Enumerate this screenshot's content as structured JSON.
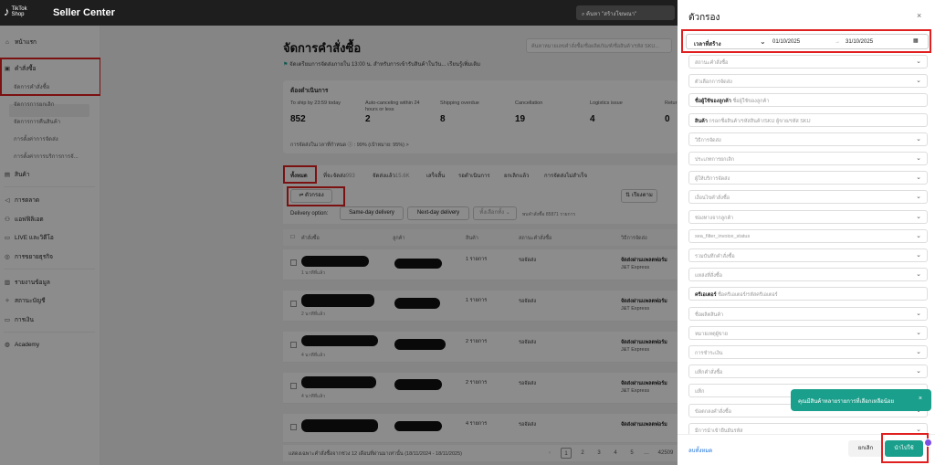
{
  "topbar": {
    "logo_line1": "TikTok",
    "logo_line2": "Shop",
    "title": "Seller Center",
    "search_placeholder": "ค้นหา \"สร้างโฆษณา\""
  },
  "sidebar": {
    "home": "หน้าแรก",
    "orders": "คำสั่งซื้อ",
    "orders_sub": [
      "จัดการคำสั่งซื้อ",
      "จัดการการยกเลิก",
      "จัดการการคืนสินค้า",
      "การตั้งค่าการจัดส่ง",
      "การตั้งค่าการบริการการจั..."
    ],
    "products": "สินค้า",
    "marketing": "การตลาด",
    "affiliate": "แอฟฟิลิเอต",
    "live": "LIVE และวิดีโอ",
    "promotion": "การขยายธุรกิจ",
    "reports": "รายงานข้อมูล",
    "account_health": "สถานะบัญชี",
    "finance": "การเงิน",
    "academy": "Academy"
  },
  "main": {
    "page_title": "จัดการคำสั่งซื้อ",
    "notice": "จัดเตรียมการจัดส่งภายใน 13:00 น. สำหรับการเข้ารับสินค้าในวัน...  เรียนรู้เพิ่มเติม",
    "search_placeholder": "ค้นหาหมายเลขคำสั่งซื้อ/ชื่อผลิตภัณฑ์/ชื่อสินค้า/รหัส SKU...",
    "todo_header": "ต้องดำเนินการ",
    "stats": [
      {
        "label": "To ship by 23:59 today",
        "value": "852"
      },
      {
        "label": "Auto-canceling within 24 hours or less",
        "value": "2"
      },
      {
        "label": "Shipping overdue",
        "value": "8"
      },
      {
        "label": "Cancellation",
        "value": "19"
      },
      {
        "label": "Logistics issue",
        "value": "4"
      },
      {
        "label": "Retur",
        "value": "0"
      }
    ],
    "ontime_rate": "การจัดส่งในเวลาที่กำหนด ⓘ : 99% (เป้าหมาย: 95%) >",
    "tabs": [
      {
        "label": "ทั้งหมด",
        "count": ""
      },
      {
        "label": "ที่จะจัดส่ง",
        "count": "993"
      },
      {
        "label": "จัดส่งแล้ว",
        "count": "15.6K"
      },
      {
        "label": "เสร็จสิ้น",
        "count": ""
      },
      {
        "label": "รอดำเนินการ",
        "count": ""
      },
      {
        "label": "ยกเลิกแล้ว",
        "count": ""
      },
      {
        "label": "การจัดส่งไม่สำเร็จ",
        "count": ""
      }
    ],
    "filter_button": "ตัวกรอง",
    "sort_button": "เรียงตาม",
    "delivery_option_label": "Delivery option:",
    "same_day": "Same-day delivery",
    "next_day": "Next-day delivery",
    "select_all": "ทั้งเลือกทั้ง",
    "selected_info": "พบคำสั่งซื้อ 85871 รายการ",
    "columns": [
      "คำสั่งซื้อ",
      "ลูกค้า",
      "สินค้า",
      "สถานะคำสั่งซื้อ",
      "วิธีการจัดส่ง"
    ],
    "rows": [
      {
        "meta": "1 นาทีที่แล้ว",
        "items": "1 รายการ",
        "status": "รอจัดส่ง",
        "ship": "จัดส่งผ่านแพลตฟอร์ม",
        "carrier": "J&T Express"
      },
      {
        "meta": "2 นาทีที่แล้ว",
        "items": "1 รายการ",
        "status": "รอจัดส่ง",
        "ship": "จัดส่งผ่านแพลตฟอร์ม",
        "carrier": "J&T Express"
      },
      {
        "meta": "4 นาทีที่แล้ว",
        "items": "2 รายการ",
        "status": "รอจัดส่ง",
        "ship": "จัดส่งผ่านแพลตฟอร์ม",
        "carrier": "J&T Express"
      },
      {
        "meta": "4 นาทีที่แล้ว",
        "items": "2 รายการ",
        "status": "รอจัดส่ง",
        "ship": "จัดส่งผ่านแพลตฟอร์ม",
        "carrier": "J&T Express"
      },
      {
        "meta": "",
        "items": "4 รายการ",
        "status": "รอจัดส่ง",
        "ship": "จัดส่งผ่านแพลตฟอร์ม",
        "carrier": ""
      }
    ],
    "pagination_info": "แสดงเฉพาะคำสั่งซื้อจากช่วง 12 เดือนที่ผ่านมาเท่านั้น (18/11/2024 - 18/11/2025)",
    "pages": [
      "1",
      "2",
      "3",
      "4",
      "5"
    ],
    "last_page": "42509"
  },
  "filter_panel": {
    "title": "ตัวกรอง",
    "date_type": "เวลาที่สร้าง",
    "date_from": "01/10/2025",
    "date_to": "31/10/2025",
    "fields": [
      {
        "label": "",
        "placeholder": "สถานะคำสั่งซื้อ",
        "dropdown": true
      },
      {
        "label": "",
        "placeholder": "ตัวเลือกการจัดส่ง",
        "dropdown": true
      },
      {
        "label": "ชื่อผู้ใช้ของลูกค้า",
        "placeholder": "ชื่อผู้ใช้ของลูกค้า",
        "dropdown": false
      },
      {
        "label": "สินค้า",
        "placeholder": "กรอกชื่อสินค้า/รหัสสินค้า/SKU ผู้ขาย/รหัส SKU",
        "dropdown": false
      },
      {
        "label": "",
        "placeholder": "วิธีการจัดส่ง",
        "dropdown": true
      },
      {
        "label": "",
        "placeholder": "ประเภทการยกเลิก",
        "dropdown": true
      },
      {
        "label": "",
        "placeholder": "ผู้ให้บริการจัดส่ง",
        "dropdown": true
      },
      {
        "label": "",
        "placeholder": "เงื่อนไขคำสั่งซื้อ",
        "dropdown": true
      },
      {
        "label": "",
        "placeholder": "ช่องทางจากลูกค้า",
        "dropdown": true
      },
      {
        "label": "",
        "placeholder": "sea_filter_invoice_status",
        "dropdown": true
      },
      {
        "label": "",
        "placeholder": "รวมบันทึกคำสั่งซื้อ",
        "dropdown": true
      },
      {
        "label": "",
        "placeholder": "แหล่งที่สั่งซื้อ",
        "dropdown": true
      },
      {
        "label": "ครีเอเตอร์",
        "placeholder": "ชื่อครีเอเตอร์/รหัสครีเอเตอร์",
        "dropdown": false
      },
      {
        "label": "",
        "placeholder": "ชื่อผลิตสินค้า",
        "dropdown": true
      },
      {
        "label": "",
        "placeholder": "หมายเหตุผู้ขาย",
        "dropdown": true
      },
      {
        "label": "",
        "placeholder": "การชำระเงิน",
        "dropdown": true
      },
      {
        "label": "",
        "placeholder": "แท็กคำสั่งซื้อ",
        "dropdown": true
      },
      {
        "label": "",
        "placeholder": "แท็ก",
        "dropdown": true
      },
      {
        "label": "",
        "placeholder": "ข้อตกลงคำสั่งซื้อ",
        "dropdown": true
      },
      {
        "label": "",
        "placeholder": "มีการนำเข้ายืนยันรหัส",
        "dropdown": true
      }
    ],
    "clear_all": "ลบทั้งหมด",
    "cancel": "ยกเลิก",
    "apply": "นำไปใช้",
    "toast": "คุณมีสินค้าหลายรายการที่เลือกเหลือน้อย"
  }
}
